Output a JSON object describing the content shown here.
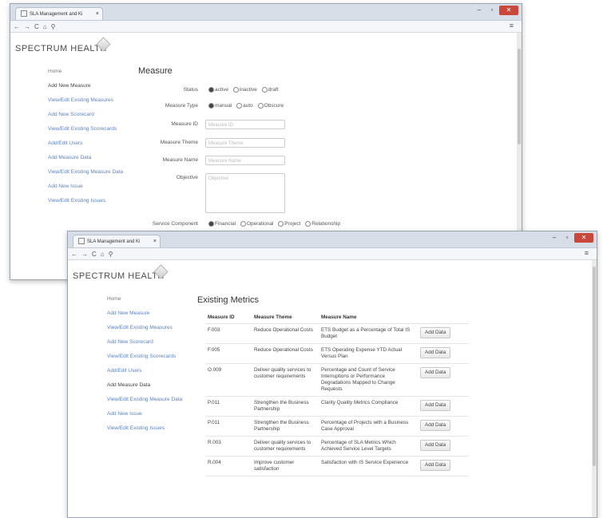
{
  "browser": {
    "tab_title": "SLA Management and Ki",
    "tab_title_2": "SLA Management and Ki",
    "tab_close": "×",
    "nav_back": "←",
    "nav_forward": "→",
    "nav_reload": "C",
    "nav_home": "⌂",
    "nav_search": "⚲",
    "menu": "≡",
    "win_min": "–",
    "win_max": "▫",
    "win_close": "✕"
  },
  "brand": {
    "logo": "SPECTRUM HEALTH"
  },
  "sidebar": {
    "items": [
      "Home",
      "Add New Measure",
      "View/Edit Existing Measures",
      "Add New Scorecard",
      "View/Edit Existing Scorecards",
      "Add/Edit Users",
      "Add Measure Data",
      "View/Edit Existing Measure Data",
      "Add New Issue",
      "View/Edit Existing Issues"
    ]
  },
  "form": {
    "heading": "Measure",
    "status_label": "Status",
    "status_options": [
      "active",
      "inactive",
      "draft"
    ],
    "type_label": "Measure Type",
    "type_options": [
      "manual",
      "auto",
      "Obscure"
    ],
    "id_label": "Measure ID",
    "id_placeholder": "Measure ID",
    "theme_label": "Measure Theme",
    "theme_placeholder": "Measure Theme",
    "name_label": "Measure Name",
    "name_placeholder": "Measure Name",
    "objective_label": "Objective",
    "objective_placeholder": "Objective",
    "component_label": "Service Component",
    "component_options": [
      "Financial",
      "Operational",
      "Project",
      "Relationship"
    ]
  },
  "metrics": {
    "heading": "Existing Metrics",
    "columns": [
      "Measure ID",
      "Measure Theme",
      "Measure Name"
    ],
    "add_label": "Add Data",
    "rows": [
      {
        "id": "F.003",
        "theme": "Reduce Operational Costs",
        "name": "ETS Budget as a Percentage of Total IS Budget"
      },
      {
        "id": "F.005",
        "theme": "Reduce Operational Costs",
        "name": "ETS Operating Expense YTD Actual Versus Plan"
      },
      {
        "id": "O.009",
        "theme": "Deliver quality services to customer requirements",
        "name": "Percentage and Count of Service Interruptions or Performance Degradations Mapped to Change Requests"
      },
      {
        "id": "P.011",
        "theme": "Strengthen the Business Partnership",
        "name": "Clarity Quality Metrics Compliance"
      },
      {
        "id": "P.011",
        "theme": "Strengthen the Business Partnership",
        "name": "Percentage of Projects with a Business Case Approval"
      },
      {
        "id": "R.003",
        "theme": "Deliver quality services to customer requirements",
        "name": "Percentage of SLA Metrics Which Achieved Service Level Targets"
      },
      {
        "id": "R.004",
        "theme": "Improve customer satisfaction",
        "name": "Satisfaction with IS Service Experience"
      }
    ]
  },
  "colors": {
    "link": "#5b82c0",
    "close_button": "#c9483b",
    "titlebar": "#d7dee8"
  }
}
